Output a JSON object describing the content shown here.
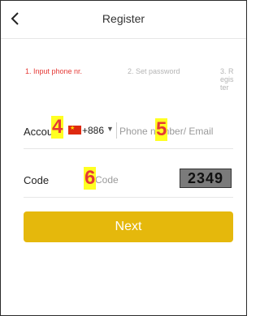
{
  "header": {
    "title": "Register"
  },
  "steps": [
    {
      "label": "1. Input phone nr.",
      "color": "#e53935"
    },
    {
      "label": "2. Set password",
      "color": "#b5b5b5"
    },
    {
      "label": "3. Register",
      "color": "#b5b5b5"
    }
  ],
  "account": {
    "label": "Account",
    "country_code": "+886",
    "flag_icon": "china-flag-icon",
    "phone_placeholder": "Phone number/ Email"
  },
  "code": {
    "label": "Code",
    "placeholder": "Code",
    "captcha": "2349"
  },
  "next_button": {
    "label": "Next",
    "color": "#e5b80c"
  },
  "markers": [
    "4",
    "5",
    "6"
  ]
}
